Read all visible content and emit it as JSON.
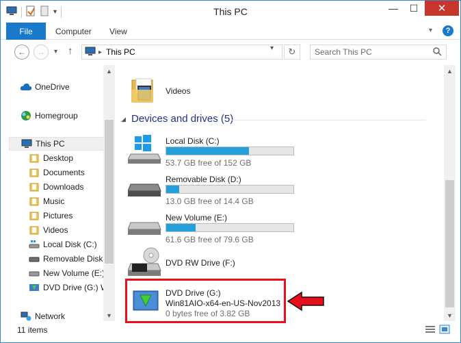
{
  "window": {
    "title": "This PC",
    "controls": {
      "minimize": "—",
      "maximize": "☐",
      "close": "✕"
    }
  },
  "ribbon": {
    "file_label": "File",
    "tabs": [
      "Computer",
      "View"
    ]
  },
  "navigation": {
    "address_path": "This PC",
    "search_placeholder": "Search This PC"
  },
  "nav_pane": {
    "items": [
      {
        "label": "OneDrive",
        "icon": "cloud-icon"
      },
      {
        "label": "Homegroup",
        "icon": "homegroup-icon"
      },
      {
        "label": "This PC",
        "icon": "computer-icon",
        "selected": true
      },
      {
        "label": "Desktop",
        "icon": "folder-icon"
      },
      {
        "label": "Documents",
        "icon": "folder-icon"
      },
      {
        "label": "Downloads",
        "icon": "folder-icon"
      },
      {
        "label": "Music",
        "icon": "folder-icon"
      },
      {
        "label": "Pictures",
        "icon": "folder-icon"
      },
      {
        "label": "Videos",
        "icon": "folder-icon"
      },
      {
        "label": "Local Disk (C:)",
        "icon": "drive-icon"
      },
      {
        "label": "Removable Disk (",
        "icon": "removable-drive-icon"
      },
      {
        "label": "New Volume (E:)",
        "icon": "drive-icon"
      },
      {
        "label": "DVD Drive (G:) W",
        "icon": "dvd-drive-icon"
      },
      {
        "label": "Network",
        "icon": "network-icon"
      }
    ]
  },
  "content": {
    "folders": [
      {
        "label": "Videos"
      }
    ],
    "group": {
      "title": "Devices and drives (5)"
    },
    "drives": [
      {
        "name": "Local Disk (C:)",
        "free_text": "53.7 GB free of 152 GB",
        "used_fraction": 0.65,
        "type": "windows-drive-icon"
      },
      {
        "name": "Removable Disk (D:)",
        "free_text": "13.0 GB free of 14.4 GB",
        "used_fraction": 0.1,
        "type": "removable-drive-icon"
      },
      {
        "name": "New Volume (E:)",
        "free_text": "61.6 GB free of 79.6 GB",
        "used_fraction": 0.23,
        "type": "drive-icon"
      },
      {
        "name": "DVD RW Drive (F:)",
        "type": "dvd-rw-drive-icon"
      },
      {
        "name": "DVD Drive (G:)",
        "label": "Win81AIO-x64-en-US-Nov2013",
        "free_text": "0 bytes free of 3.82 GB",
        "type": "dvd-drive-icon"
      }
    ]
  },
  "status": {
    "items_count": "11 items"
  },
  "colors": {
    "accent": "#1979ca",
    "bar_fill": "#26a0da",
    "annotation": "#e8101a",
    "close": "#c7352b"
  }
}
